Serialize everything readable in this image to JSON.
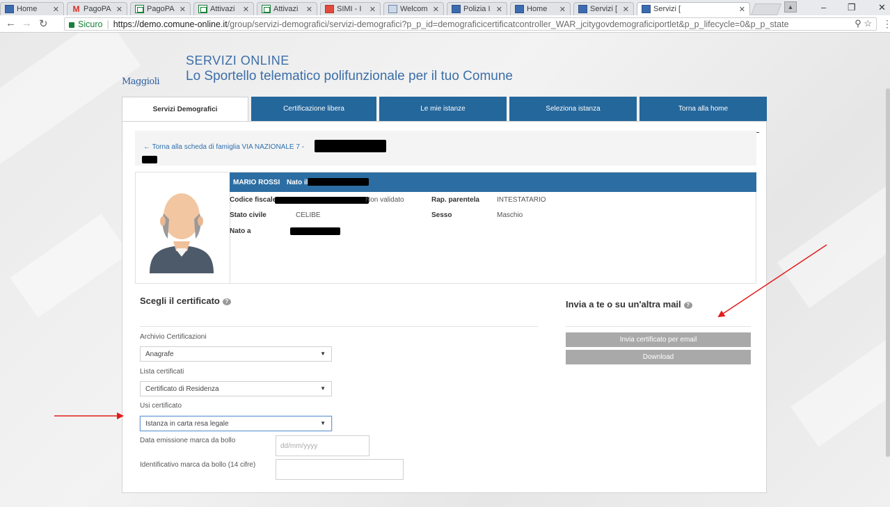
{
  "browser": {
    "tabs": [
      {
        "title": "Home",
        "favicon": "blue-square-icon"
      },
      {
        "title": "PagoPA",
        "favicon": "gmail-icon"
      },
      {
        "title": "PagoPA",
        "favicon": "sheet-icon"
      },
      {
        "title": "Attivazi",
        "favicon": "sheet-icon"
      },
      {
        "title": "Attivazi",
        "favicon": "sheet-icon"
      },
      {
        "title": "SIMI - I",
        "favicon": "calendar-icon"
      },
      {
        "title": "Welcom",
        "favicon": "image-icon"
      },
      {
        "title": "Polizia I",
        "favicon": "blue-square-icon"
      },
      {
        "title": "Home",
        "favicon": "blue-square-icon"
      },
      {
        "title": "Servizi [",
        "favicon": "blue-square-icon"
      },
      {
        "title": "Servizi [",
        "favicon": "blue-square-icon"
      }
    ],
    "active_tab": 10,
    "secure_label": "Sicuro",
    "url_main": "https://demo.comune-online.it",
    "url_rest": "/group/servizi-demografici/servizi-demografici?p_p_id=demograficicertificatcontroller_WAR_jcitygovdemograficiportlet&p_p_lifecycle=0&p_p_state"
  },
  "site": {
    "logo": "Maggioli",
    "title": "SERVIZI ONLINE",
    "subtitle": "Lo Sportello telematico polifunzionale per il tuo Comune"
  },
  "nav": {
    "tabs": [
      "Servizi Demografici",
      "Certificazione libera",
      "Le mie istanze",
      "Seleziona istanza",
      "Torna alla home"
    ]
  },
  "back": {
    "link": "← Torna alla scheda di famiglia VIA NAZIONALE 7 -"
  },
  "person": {
    "name": "MARIO ROSSI",
    "born_label": "Nato il",
    "codice_fiscale_label": "Codice fiscale",
    "codice_fiscale_status": "Non validato",
    "rap_parentela_label": "Rap. parentela",
    "rap_parentela_value": "INTESTATARIO",
    "stato_civile_label": "Stato civile",
    "stato_civile_value": "CELIBE",
    "sesso_label": "Sesso",
    "sesso_value": "Maschio",
    "nato_a_label": "Nato a"
  },
  "certificate": {
    "heading": "Scegli il certificato",
    "archivio_label": "Archivio Certificazioni",
    "archivio_value": "Anagrafe",
    "lista_label": "Lista certificati",
    "lista_value": "Certificato di Residenza",
    "usi_label": "Usi certificato",
    "usi_value": "Istanza in carta resa legale",
    "data_marca_label": "Data emissione marca da bollo",
    "data_marca_placeholder": "dd/mm/yyyy",
    "id_marca_label": "Identificativo marca da bollo (14 cifre)"
  },
  "mail": {
    "heading": "Invia a te o su un'altra mail",
    "email_button": "Invia certificato per email",
    "download_button": "Download"
  },
  "colors": {
    "nav_blue": "#24679b",
    "band_blue": "#2c6ea3",
    "button_gray": "#a9a9a9",
    "annotation_red": "#e21b1b"
  }
}
